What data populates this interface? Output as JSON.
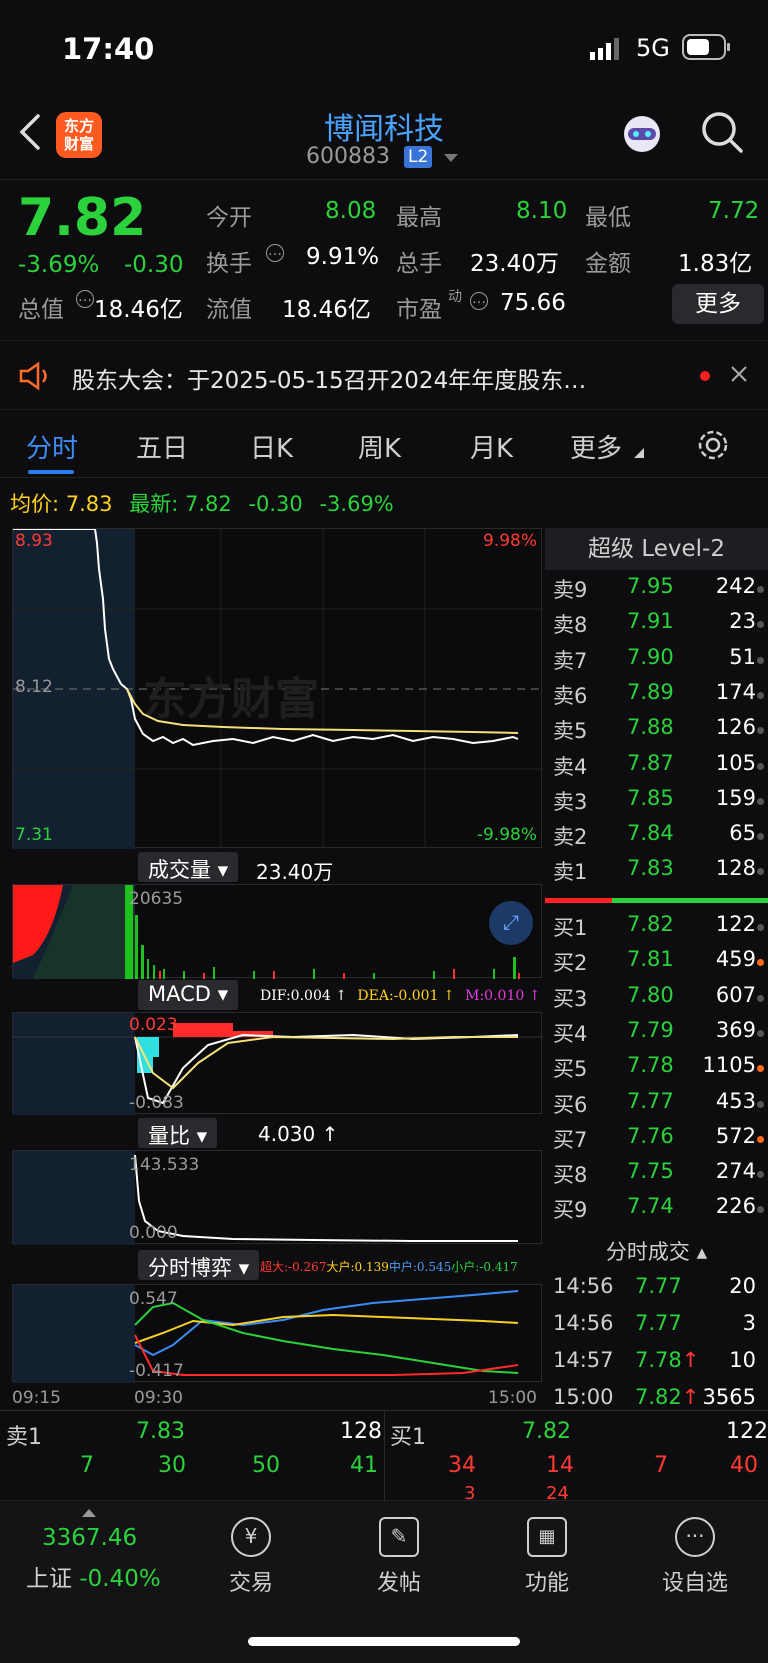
{
  "status": {
    "time": "17:40",
    "network": "5G"
  },
  "header": {
    "title": "博闻科技",
    "code": "600883",
    "level_badge": "L2",
    "logo_line1": "东方",
    "logo_line2": "财富"
  },
  "quote": {
    "price": "7.82",
    "pct": "-3.69%",
    "chg": "-0.30",
    "open_label": "今开",
    "open": "8.08",
    "high_label": "最高",
    "high": "8.10",
    "low_label": "最低",
    "low": "7.72",
    "turnover_label": "换手",
    "turnover": "9.91%",
    "volume_label": "总手",
    "volume": "23.40万",
    "amount_label": "金额",
    "amount": "1.83亿",
    "mktcap_label": "总值",
    "mktcap": "18.46亿",
    "float_label": "流值",
    "float": "18.46亿",
    "pe_label": "市盈",
    "pe_sup": "动",
    "pe": "75.66",
    "more": "更多"
  },
  "notice": {
    "text": "股东大会：于2025-05-15召开2024年年度股东…"
  },
  "tabs": [
    "分时",
    "五日",
    "日K",
    "周K",
    "月K",
    "更多"
  ],
  "avg_bar": {
    "avg_label": "均价:",
    "avg": "7.83",
    "latest_label": "最新:",
    "latest": "7.82",
    "chg": "-0.30",
    "pct": "-3.69%"
  },
  "chart": {
    "price_high": "8.93",
    "price_mid": "8.12",
    "price_low": "7.31",
    "pct_high": "9.98%",
    "pct_low": "-9.98%",
    "watermark": "东方财富",
    "vol_title": "成交量",
    "vol_value": "23.40万",
    "vol_max": "20635",
    "macd_title": "MACD",
    "dif": "DIF:0.004 ↑",
    "dea": "DEA:-0.001 ↑",
    "m": "M:0.010 ↑",
    "macd_high": "0.023",
    "macd_low": "-0.083",
    "lb_title": "量比",
    "lb_value": "4.030 ↑",
    "lb_high": "143.533",
    "lb_low": "0.000",
    "by_title": "分时博弈",
    "chaoda": "超大:-0.267",
    "dahu": "大户:0.139",
    "zhonghu": "中户:0.545",
    "xiaohu": "小户:-0.417",
    "by_high": "0.547",
    "by_low": "-0.417",
    "t0": "09:15",
    "t1": "09:30",
    "t2": "15:00"
  },
  "orderbook": {
    "title": "超级 Level-2",
    "asks": [
      {
        "label": "卖9",
        "price": "7.95",
        "vol": "242"
      },
      {
        "label": "卖8",
        "price": "7.91",
        "vol": "23"
      },
      {
        "label": "卖7",
        "price": "7.90",
        "vol": "51"
      },
      {
        "label": "卖6",
        "price": "7.89",
        "vol": "174"
      },
      {
        "label": "卖5",
        "price": "7.88",
        "vol": "126"
      },
      {
        "label": "卖4",
        "price": "7.87",
        "vol": "105"
      },
      {
        "label": "卖3",
        "price": "7.85",
        "vol": "159"
      },
      {
        "label": "卖2",
        "price": "7.84",
        "vol": "65"
      },
      {
        "label": "卖1",
        "price": "7.83",
        "vol": "128"
      }
    ],
    "bids": [
      {
        "label": "买1",
        "price": "7.82",
        "vol": "122"
      },
      {
        "label": "买2",
        "price": "7.81",
        "vol": "459"
      },
      {
        "label": "买3",
        "price": "7.80",
        "vol": "607"
      },
      {
        "label": "买4",
        "price": "7.79",
        "vol": "369"
      },
      {
        "label": "买5",
        "price": "7.78",
        "vol": "1105"
      },
      {
        "label": "买6",
        "price": "7.77",
        "vol": "453"
      },
      {
        "label": "买7",
        "price": "7.76",
        "vol": "572"
      },
      {
        "label": "买8",
        "price": "7.75",
        "vol": "274"
      },
      {
        "label": "买9",
        "price": "7.74",
        "vol": "226"
      }
    ],
    "ticks_title": "分时成交",
    "ticks": [
      {
        "time": "14:56",
        "price": "7.77",
        "vol": "20"
      },
      {
        "time": "14:56",
        "price": "7.77",
        "vol": "3"
      },
      {
        "time": "14:57",
        "price": "7.78↑",
        "vol": "10"
      },
      {
        "time": "15:00",
        "price": "7.82↑",
        "vol": "3565"
      }
    ]
  },
  "depth": {
    "ask_label": "卖1",
    "ask_price": "7.83",
    "ask_vol": "128",
    "bid_label": "买1",
    "bid_price": "7.82",
    "bid_vol": "122",
    "ask_queue": [
      "7",
      "30",
      "50",
      "41"
    ],
    "bid_queue": [
      "34",
      "14",
      "7",
      "40"
    ],
    "bid_queue2": [
      "3",
      "24"
    ]
  },
  "nav": {
    "index_value": "3367.46",
    "index_name": "上证",
    "index_pct": "-0.40%",
    "items": [
      "交易",
      "发帖",
      "功能",
      "设自选"
    ]
  }
}
